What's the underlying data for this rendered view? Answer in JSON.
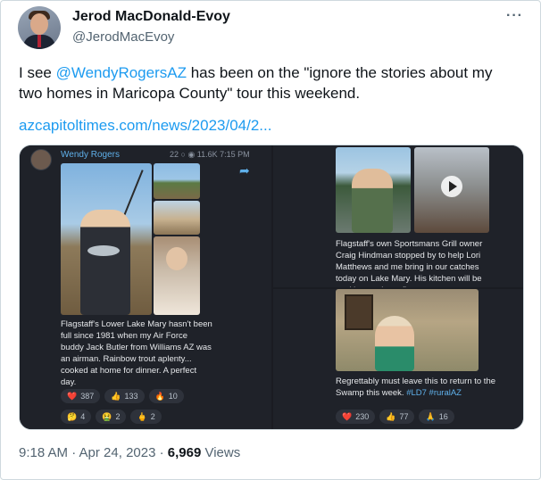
{
  "author": {
    "name": "Jerod MacDonald-Evoy",
    "handle": "@JerodMacEvoy"
  },
  "more_label": "···",
  "tweet": {
    "text_before": "I see ",
    "mention": "@WendyRogersAZ",
    "text_after": " has been on the \"ignore the stories about my two homes in Maricopa County\" tour this weekend.",
    "link": "azcapitoltimes.com/news/2023/04/2..."
  },
  "media": {
    "post1": {
      "channel": "Wendy Rogers",
      "meta": "22 ○ ◉ 11.6K 7:15 PM",
      "caption": "Flagstaff's Lower Lake Mary hasn't been full since 1981 when my Air Force buddy Jack Butler from Williams AZ was an airman. Rainbow trout aplenty... cooked at home for dinner. A perfect day.",
      "reactions_row1": [
        {
          "icon": "❤️",
          "count": "387"
        },
        {
          "icon": "👍",
          "count": "133"
        },
        {
          "icon": "🔥",
          "count": "10"
        }
      ],
      "reactions_row2": [
        {
          "icon": "🤔",
          "count": "4"
        },
        {
          "icon": "🤮",
          "count": "2"
        },
        {
          "icon": "🖕",
          "count": "2"
        }
      ]
    },
    "post2": {
      "caption": "Flagstaff's own Sportsmans Grill owner Craig Hindman stopped by to help Lori Matthews and me bring in our catches today on Lake Mary. His kitchen will be cooking up those fine"
    },
    "post3": {
      "caption": "Regrettably must leave this to return to the Swamp this week. ",
      "tags": "#LD7 #ruralAZ",
      "reactions": [
        {
          "icon": "❤️",
          "count": "230"
        },
        {
          "icon": "👍",
          "count": "77"
        },
        {
          "icon": "🙏",
          "count": "16"
        }
      ]
    }
  },
  "footer": {
    "time_date": "9:18 AM · Apr 24, 2023 · ",
    "views_count": "6,969",
    "views_label": " Views"
  }
}
